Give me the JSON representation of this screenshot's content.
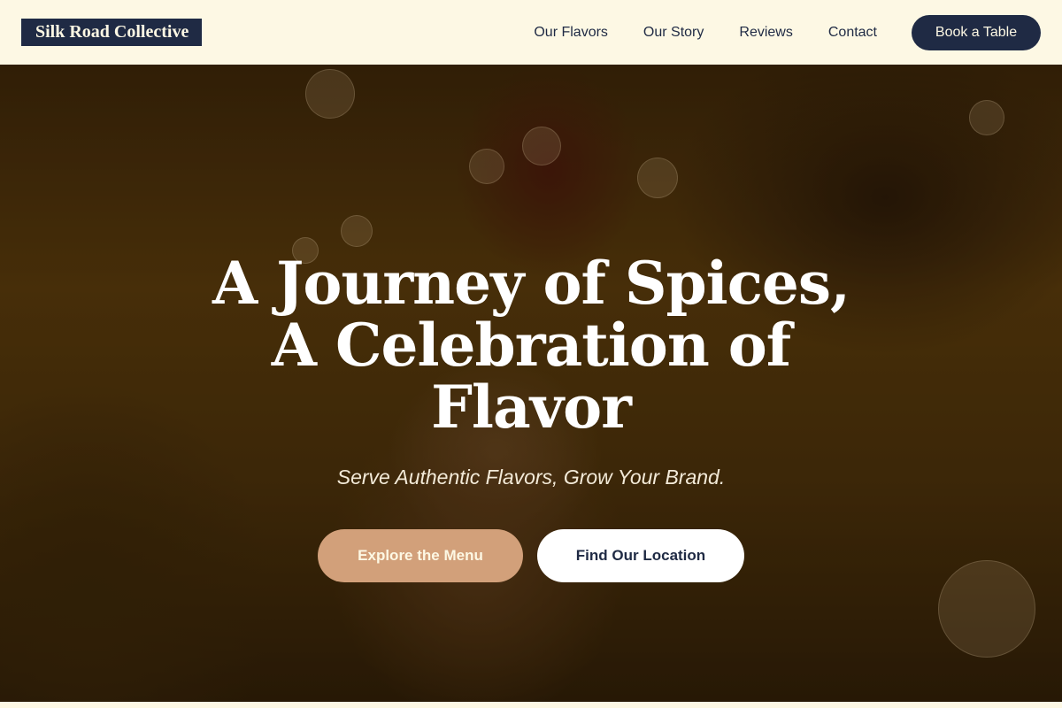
{
  "brand": {
    "logo_text": "Silk Road Collective"
  },
  "nav": {
    "links": [
      {
        "label": "Our Flavors"
      },
      {
        "label": "Our Story"
      },
      {
        "label": "Reviews"
      },
      {
        "label": "Contact"
      }
    ],
    "cta_label": "Book a Table"
  },
  "hero": {
    "title": "A Journey of Spices, A Celebration of Flavor",
    "subtitle": "Serve Authentic Flavors, Grow Your Brand.",
    "primary_cta": "Explore the Menu",
    "secondary_cta": "Find Our Location"
  },
  "colors": {
    "navy": "#1f2a44",
    "cream": "#fdf8e4",
    "tan_accent": "#d2a07a",
    "white": "#ffffff"
  }
}
